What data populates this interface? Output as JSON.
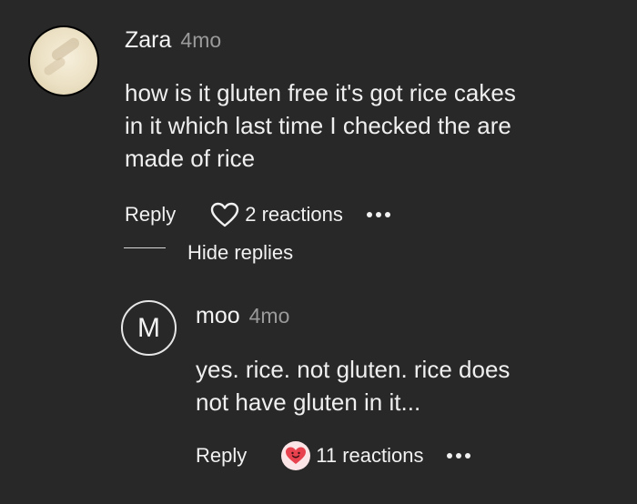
{
  "comment": {
    "author": "Zara",
    "time": "4mo",
    "lines": [
      "how is it gluten free it's got rice cakes",
      "in it which last time I checked the are",
      "made of rice"
    ],
    "reply_label": "Reply",
    "reactions_label": "2 reactions",
    "hide_replies_label": "Hide replies"
  },
  "reply": {
    "avatar_letter": "M",
    "author": "moo",
    "time": "4mo",
    "lines": [
      "yes. rice. not gluten. rice does",
      "not have gluten in it..."
    ],
    "reply_label": "Reply",
    "reactions_label": "11 reactions"
  },
  "icons": {
    "heart_outline": "heart-outline-icon",
    "heart_face": "heart-face-emoji-icon",
    "more": "more-dots-icon"
  },
  "colors": {
    "background": "#282828",
    "text": "#f1f1f1",
    "muted": "#9a9a9a",
    "reaction_red": "#e8424f"
  }
}
